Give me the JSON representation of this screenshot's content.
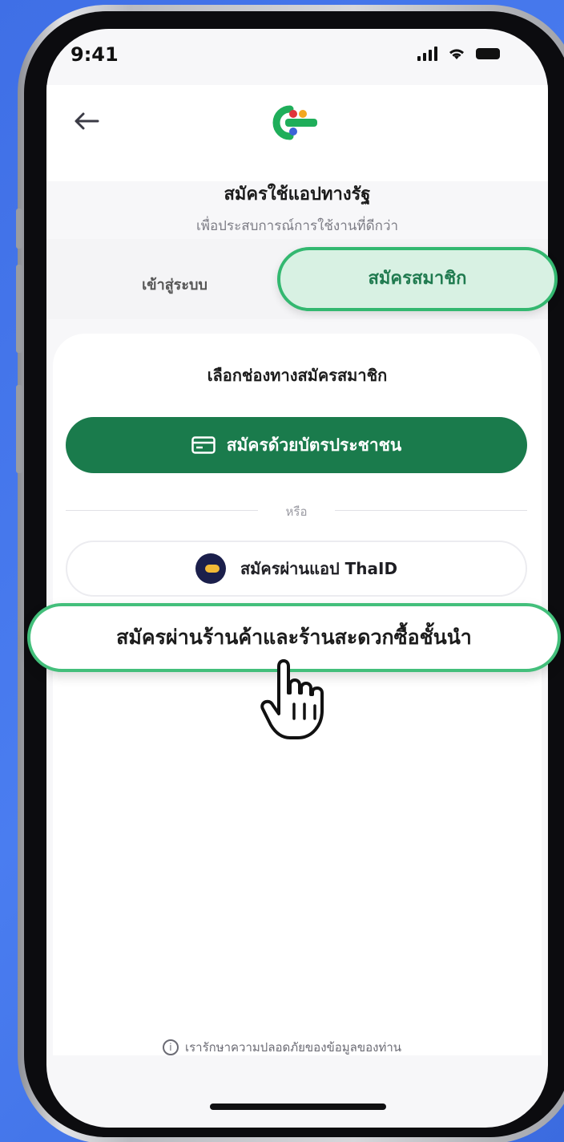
{
  "status_bar": {
    "time": "9:41"
  },
  "header": {
    "back_icon": "arrow-left-icon",
    "logo": "thangrat-logo"
  },
  "page": {
    "title": "สมัครใช้แอปทางรัฐ",
    "subtitle": "เพื่อประสบการณ์การใช้งานที่ดีกว่า"
  },
  "tabs": [
    {
      "label": "เข้าสู่ระบบ",
      "active": false
    },
    {
      "label": "สมัครสมาชิก",
      "active": true
    }
  ],
  "card": {
    "title": "เลือกช่องทางสมัครสมาชิก",
    "id_card_button": "สมัครด้วยบัตรประชาชน",
    "divider_text": "หรือ",
    "thaid_button": "สมัครผ่านแอป ThaID",
    "store_button": "สมัครผ่านร้านค้าและร้านสะดวกซื้อชั้นนำ"
  },
  "footer": {
    "privacy_text": "เรารักษาความปลอดภัยของข้อมูลของท่าน"
  },
  "colors": {
    "primary_green": "#1a7b4c",
    "highlight_green": "#33b870",
    "background_blue": "#4a7df0"
  }
}
